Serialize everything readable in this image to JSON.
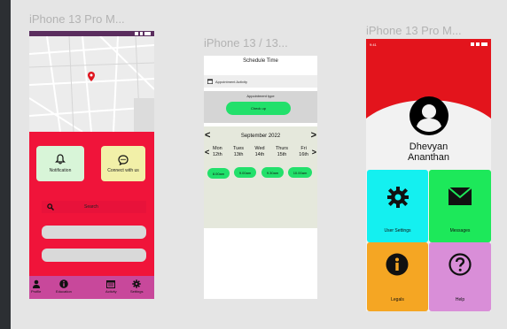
{
  "frames": {
    "f1": {
      "label": "iPhone 13 Pro M..."
    },
    "f2": {
      "label": "iPhone 13 / 13..."
    },
    "f3": {
      "label": "iPhone 13 Pro M..."
    }
  },
  "home": {
    "notification_label": "Notification",
    "connect_label": "Connect with us",
    "search_label": "Search",
    "nav": [
      {
        "label": "Profile",
        "icon": "user-icon"
      },
      {
        "label": "Education",
        "icon": "info-icon"
      },
      {
        "label": "Activity",
        "icon": "calendar-icon"
      },
      {
        "label": "Settings",
        "icon": "gear-icon"
      }
    ]
  },
  "schedule": {
    "title": "Schedule Time",
    "activity_label": "Appointment Activity",
    "type_label": "Appointment type",
    "checkup_label": "Check up",
    "month": "September 2022",
    "days": [
      {
        "name": "Mon",
        "date": "12th"
      },
      {
        "name": "Tues",
        "date": "13th"
      },
      {
        "name": "Wed",
        "date": "14th"
      },
      {
        "name": "Thurs",
        "date": "15th"
      },
      {
        "name": "Fri",
        "date": "16th"
      }
    ],
    "times": [
      "8.00am",
      "9.00am",
      "9.30am",
      "10.00am"
    ]
  },
  "profile": {
    "first_name": "Dhevyan",
    "last_name": "Ananthan",
    "statusbar_time": "9:41",
    "tiles": [
      {
        "label": "User Settings",
        "color": "#14f0f0",
        "icon": "gear-icon"
      },
      {
        "label": "Messages",
        "color": "#1de85a",
        "icon": "mail-icon"
      },
      {
        "label": "Legals",
        "color": "#f5a623",
        "icon": "info-icon"
      },
      {
        "label": "Help",
        "color": "#d98ed8",
        "icon": "help-icon"
      }
    ]
  },
  "colors": {
    "accent_red": "#f0143a",
    "nav_pink": "#c8489b",
    "green": "#22e06b"
  }
}
